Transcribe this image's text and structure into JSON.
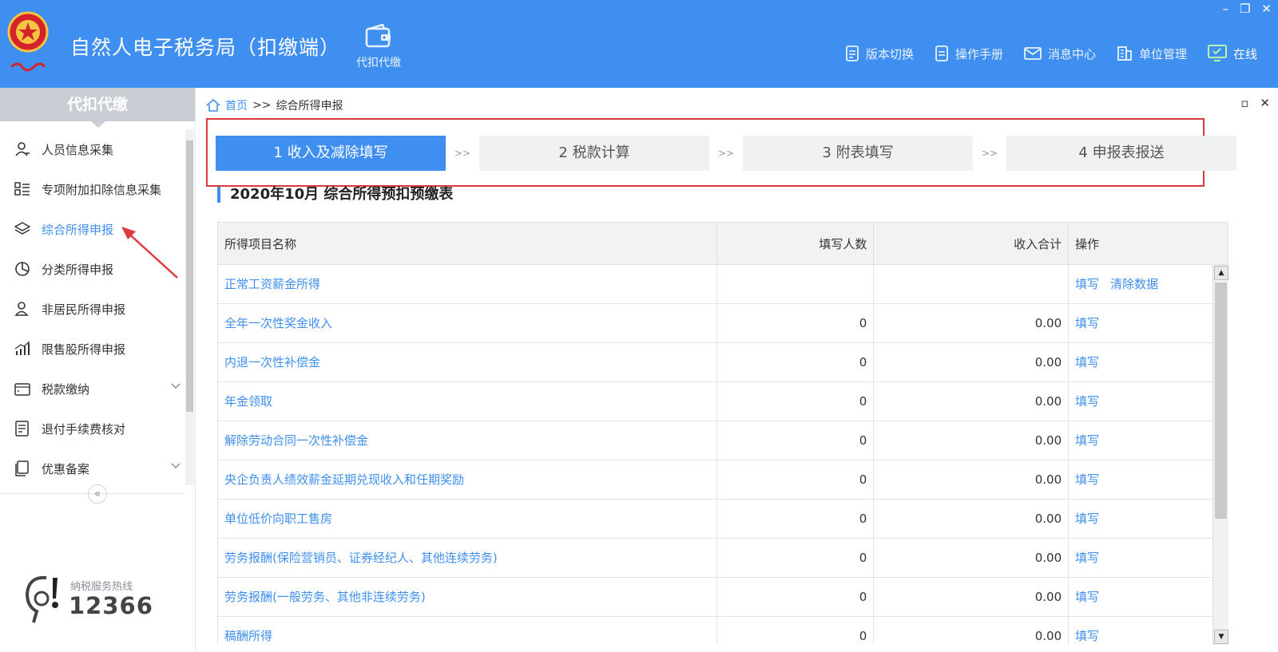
{
  "header": {
    "title": "自然人电子税务局（扣缴端）",
    "module_label": "代扣代缴",
    "nav": [
      {
        "label": "版本切换",
        "icon": "document-icon"
      },
      {
        "label": "操作手册",
        "icon": "manual-icon"
      },
      {
        "label": "消息中心",
        "icon": "mail-icon"
      },
      {
        "label": "单位管理",
        "icon": "building-icon"
      },
      {
        "label": "在线",
        "icon": "monitor-icon"
      }
    ],
    "window_controls": {
      "minimize": "–",
      "restore": "❐",
      "close": "✕"
    }
  },
  "sidebar": {
    "title": "代扣代缴",
    "items": [
      {
        "label": "人员信息采集",
        "icon": "person-icon"
      },
      {
        "label": "专项附加扣除信息采集",
        "icon": "list-icon"
      },
      {
        "label": "综合所得申报",
        "icon": "layers-icon",
        "active": true
      },
      {
        "label": "分类所得申报",
        "icon": "pie-icon"
      },
      {
        "label": "非居民所得申报",
        "icon": "user-icon"
      },
      {
        "label": "限售股所得申报",
        "icon": "bar-chart-icon"
      },
      {
        "label": "税款缴纳",
        "icon": "wallet-icon",
        "expandable": true
      },
      {
        "label": "退付手续费核对",
        "icon": "receipt-icon"
      },
      {
        "label": "优惠备案",
        "icon": "file-icon",
        "expandable": true
      }
    ],
    "collapse_glyph": "«",
    "hotline": {
      "label": "纳税服务热线",
      "number": "12366"
    }
  },
  "breadcrumb": {
    "home": "首页",
    "separator": ">>",
    "current": "综合所得申报"
  },
  "panel_controls": {
    "restore": "▫",
    "close": "✕"
  },
  "steps": [
    {
      "label": "1 收入及减除填写",
      "active": true
    },
    {
      "label": "2 税款计算",
      "active": false
    },
    {
      "label": "3 附表填写",
      "active": false
    },
    {
      "label": "4 申报表报送",
      "active": false
    }
  ],
  "step_separator": ">>",
  "table": {
    "title": "2020年10月  综合所得预扣预缴表",
    "columns": [
      "所得项目名称",
      "填写人数",
      "收入合计",
      "操作"
    ],
    "rows": [
      {
        "name": "正常工资薪金所得",
        "count": "",
        "income": "",
        "actions": [
          "填写",
          "清除数据"
        ]
      },
      {
        "name": "全年一次性奖金收入",
        "count": "0",
        "income": "0.00",
        "actions": [
          "填写"
        ]
      },
      {
        "name": "内退一次性补偿金",
        "count": "0",
        "income": "0.00",
        "actions": [
          "填写"
        ]
      },
      {
        "name": "年金领取",
        "count": "0",
        "income": "0.00",
        "actions": [
          "填写"
        ]
      },
      {
        "name": "解除劳动合同一次性补偿金",
        "count": "0",
        "income": "0.00",
        "actions": [
          "填写"
        ]
      },
      {
        "name": "央企负责人绩效薪金延期兑现收入和任期奖励",
        "count": "0",
        "income": "0.00",
        "actions": [
          "填写"
        ]
      },
      {
        "name": "单位低价向职工售房",
        "count": "0",
        "income": "0.00",
        "actions": [
          "填写"
        ]
      },
      {
        "name": "劳务报酬(保险营销员、证券经纪人、其他连续劳务)",
        "count": "0",
        "income": "0.00",
        "actions": [
          "填写"
        ]
      },
      {
        "name": "劳务报酬(一般劳务、其他非连续劳务)",
        "count": "0",
        "income": "0.00",
        "actions": [
          "填写"
        ]
      },
      {
        "name": "稿酬所得",
        "count": "0",
        "income": "0.00",
        "actions": [
          "填写"
        ]
      }
    ]
  },
  "colors": {
    "accent": "#3f8ff0",
    "highlight_border": "#d9393b",
    "sidebar_head": "#c9ced4"
  }
}
